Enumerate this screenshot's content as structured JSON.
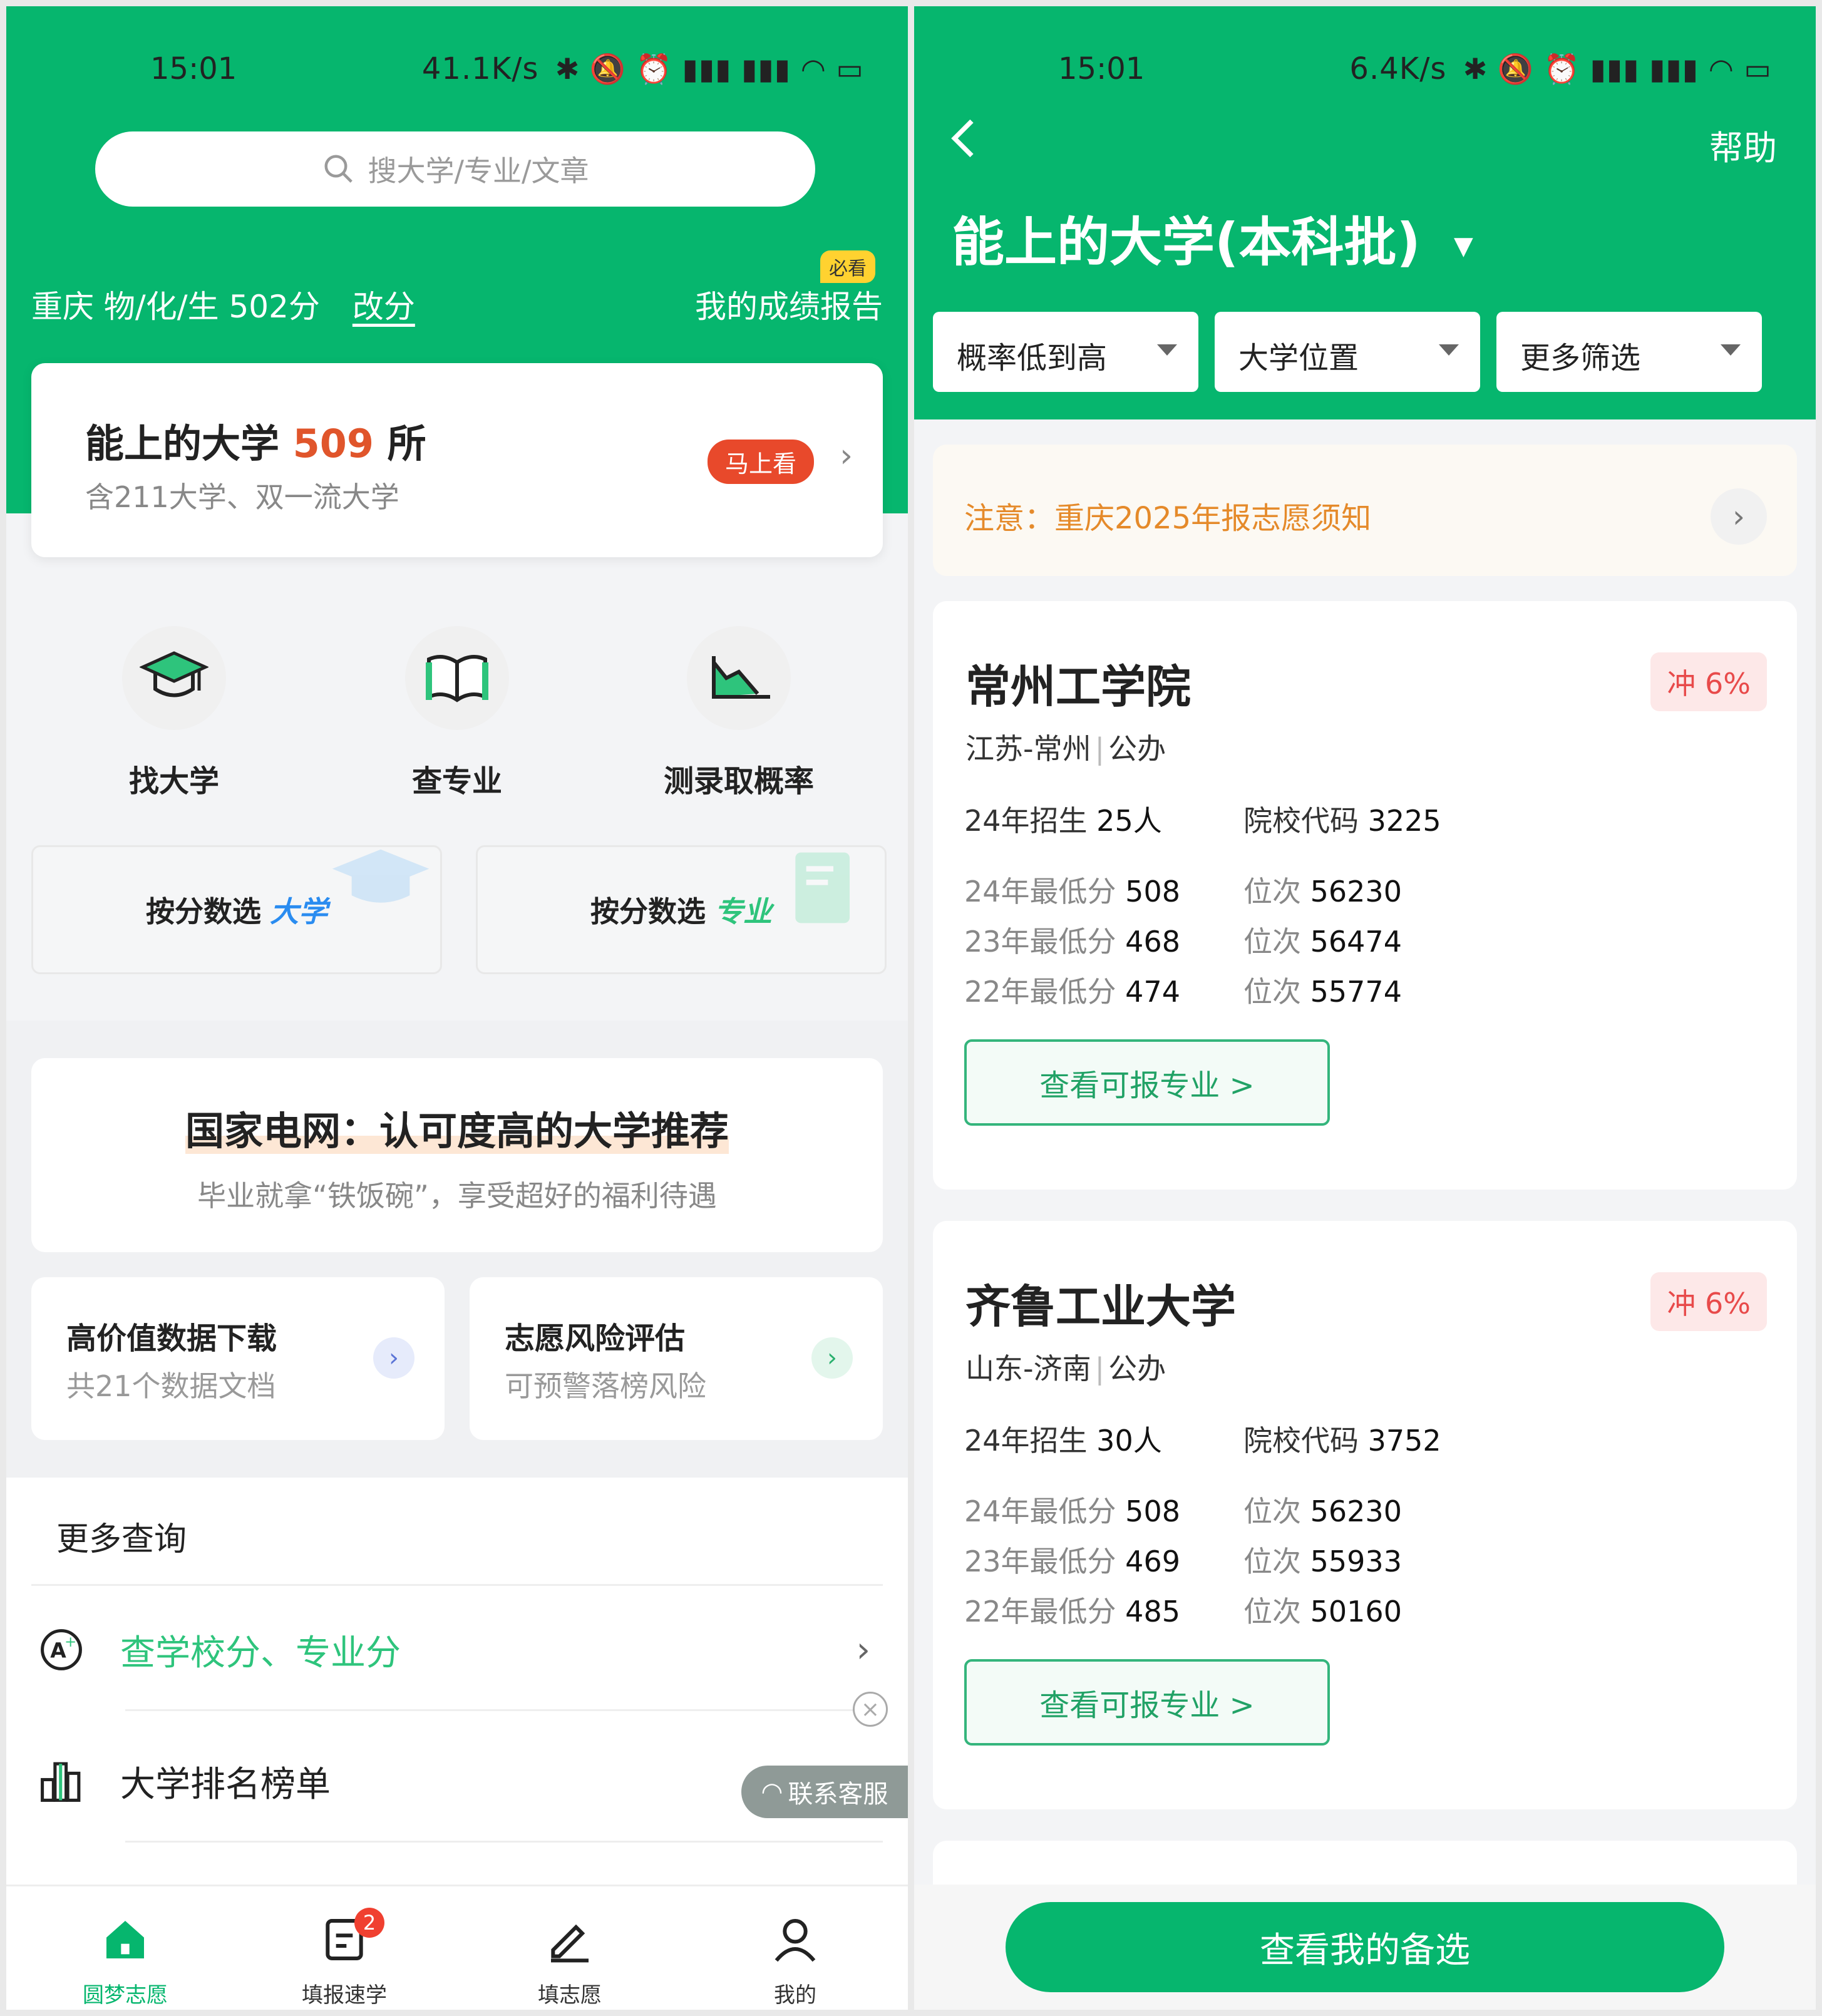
{
  "left": {
    "status": {
      "time": "15:01",
      "speed": "41.1K/s"
    },
    "search": {
      "placeholder": "搜大学/专业/文章"
    },
    "score": {
      "summary": "重庆 物/化/生 502分",
      "change_label": "改分"
    },
    "report": {
      "badge": "必看",
      "label": "我的成绩报告"
    },
    "uni_card": {
      "prefix": "能上的大学",
      "count": "509",
      "suffix": "所",
      "subtitle": "含211大学、双一流大学",
      "button": "马上看"
    },
    "tools": [
      {
        "label": "找大学",
        "icon": "graduation-cap-icon"
      },
      {
        "label": "查专业",
        "icon": "open-book-icon"
      },
      {
        "label": "测录取概率",
        "icon": "area-chart-icon"
      }
    ],
    "picks": [
      {
        "label": "按分数选",
        "highlight": "大学"
      },
      {
        "label": "按分数选",
        "highlight": "专业"
      }
    ],
    "banner": {
      "title": "国家电网：认可度高的大学推荐",
      "subtitle": "毕业就拿“铁饭碗”，享受超好的福利待遇"
    },
    "mini_cards": [
      {
        "title": "高价值数据下载",
        "subtitle": "共21个数据文档"
      },
      {
        "title": "志愿风险评估",
        "subtitle": "可预警落榜风险"
      }
    ],
    "more": {
      "title": "更多查询",
      "rows": [
        {
          "label": "查学校分、专业分",
          "icon": "a-plus-icon"
        },
        {
          "label": "大学排名榜单",
          "icon": "bar-chart-icon"
        }
      ]
    },
    "customer_service": "联系客服",
    "tabs": [
      {
        "label": "圆梦志愿",
        "icon": "home-icon"
      },
      {
        "label": "填报速学",
        "icon": "document-icon",
        "badge": "2"
      },
      {
        "label": "填志愿",
        "icon": "pen-icon"
      },
      {
        "label": "我的",
        "icon": "user-icon"
      }
    ]
  },
  "right": {
    "status": {
      "time": "15:01",
      "speed": "6.4K/s"
    },
    "help": "帮助",
    "title": "能上的大学(本科批)",
    "filters": [
      "概率低到高",
      "大学位置",
      "更多筛选"
    ],
    "notice": "注意：重庆2025年报志愿须知",
    "schools": [
      {
        "name": "常州工学院",
        "prob": "冲 6%",
        "region": "江苏-常州",
        "type": "公办",
        "enroll_label": "24年招生",
        "enroll_value": "25人",
        "code_label": "院校代码",
        "code_value": "3225",
        "rows": [
          {
            "year_label": "24年最低分",
            "score": "508",
            "rank_label": "位次",
            "rank": "56230"
          },
          {
            "year_label": "23年最低分",
            "score": "468",
            "rank_label": "位次",
            "rank": "56474"
          },
          {
            "year_label": "22年最低分",
            "score": "474",
            "rank_label": "位次",
            "rank": "55774"
          }
        ],
        "button": "查看可报专业 >"
      },
      {
        "name": "齐鲁工业大学",
        "prob": "冲 6%",
        "region": "山东-济南",
        "type": "公办",
        "enroll_label": "24年招生",
        "enroll_value": "30人",
        "code_label": "院校代码",
        "code_value": "3752",
        "rows": [
          {
            "year_label": "24年最低分",
            "score": "508",
            "rank_label": "位次",
            "rank": "56230"
          },
          {
            "year_label": "23年最低分",
            "score": "469",
            "rank_label": "位次",
            "rank": "55933"
          },
          {
            "year_label": "22年最低分",
            "score": "485",
            "rank_label": "位次",
            "rank": "50160"
          }
        ],
        "button": "查看可报专业 >"
      }
    ],
    "cta": "查看我的备选"
  },
  "colors": {
    "brand_green": "#06b66e",
    "accent_red": "#e8492b",
    "notice_orange": "#e58a2a"
  }
}
